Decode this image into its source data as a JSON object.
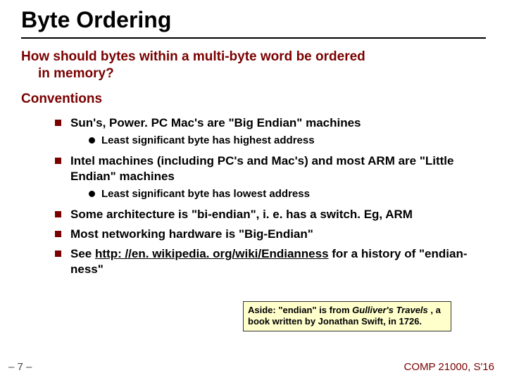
{
  "title": "Byte Ordering",
  "q_line1": "How should bytes within a multi-byte word be ordered",
  "q_line2": "in memory?",
  "conv_heading": "Conventions",
  "b1": "Sun's, Power. PC Mac's are \"Big Endian\" machines",
  "b1s": "Least significant byte has highest address",
  "b2": "Intel machines (including PC's and Mac's) and most ARM are \"Little Endian\" machines",
  "b2s": "Least significant byte has lowest address",
  "b3": "Some architecture is \"bi-endian\", i. e. has a switch.  Eg, ARM",
  "b4": "Most networking hardware is \"Big-Endian\"",
  "b5a": "See ",
  "b5link": "http: //en. wikipedia. org/wiki/Endianness",
  "b5b": " for a history of \"endian-ness\"",
  "aside_a": "Aside:  \"endian\" is from ",
  "aside_it": "Gulliver's Travels",
  "aside_b": " , a book written by Jonathan Swift, in 1726.",
  "footer_left": "– 7 –",
  "footer_right": "COMP 21000, S'16"
}
